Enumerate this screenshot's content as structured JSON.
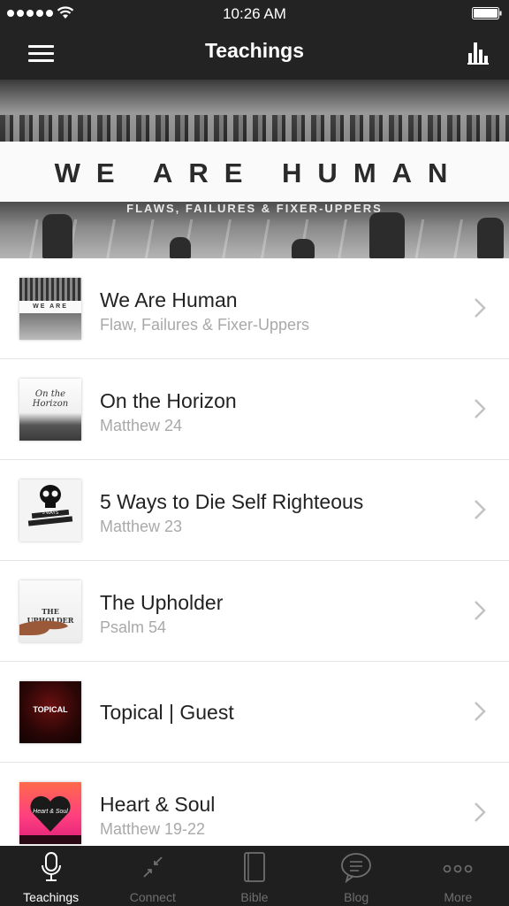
{
  "status_bar": {
    "time": "10:26 AM"
  },
  "nav": {
    "title": "Teachings"
  },
  "hero": {
    "title": "WE ARE HUMAN",
    "subtitle": "FLAWS, FAILURES & FIXER-UPPERS"
  },
  "teachings": [
    {
      "title": "We Are Human",
      "subtitle": "Flaw, Failures & Fixer-Uppers",
      "thumb_text": "WE ARE HUMAN"
    },
    {
      "title": "On the Horizon",
      "subtitle": "Matthew 24",
      "thumb_text": "On the Horizon"
    },
    {
      "title": "5 Ways to Die Self Righteous",
      "subtitle": "Matthew 23",
      "thumb_text": "5 WAYS"
    },
    {
      "title": "The Upholder",
      "subtitle": "Psalm 54",
      "thumb_text": "THE UPHOLDER"
    },
    {
      "title": "Topical | Guest",
      "subtitle": "",
      "thumb_text": "TOPICAL"
    },
    {
      "title": "Heart & Soul",
      "subtitle": "Matthew 19-22",
      "thumb_text": "Heart & Soul"
    }
  ],
  "tabs": [
    {
      "label": "Teachings",
      "icon": "microphone-icon",
      "active": true
    },
    {
      "label": "Connect",
      "icon": "connect-arrows-icon",
      "active": false
    },
    {
      "label": "Bible",
      "icon": "book-icon",
      "active": false
    },
    {
      "label": "Blog",
      "icon": "chat-bubble-icon",
      "active": false
    },
    {
      "label": "More",
      "icon": "more-dots-icon",
      "active": false
    }
  ],
  "colors": {
    "bar_bg": "#232323",
    "tab_active": "#ffffff",
    "tab_inactive": "#6f6f6f",
    "subtitle": "#a9a9a9"
  }
}
